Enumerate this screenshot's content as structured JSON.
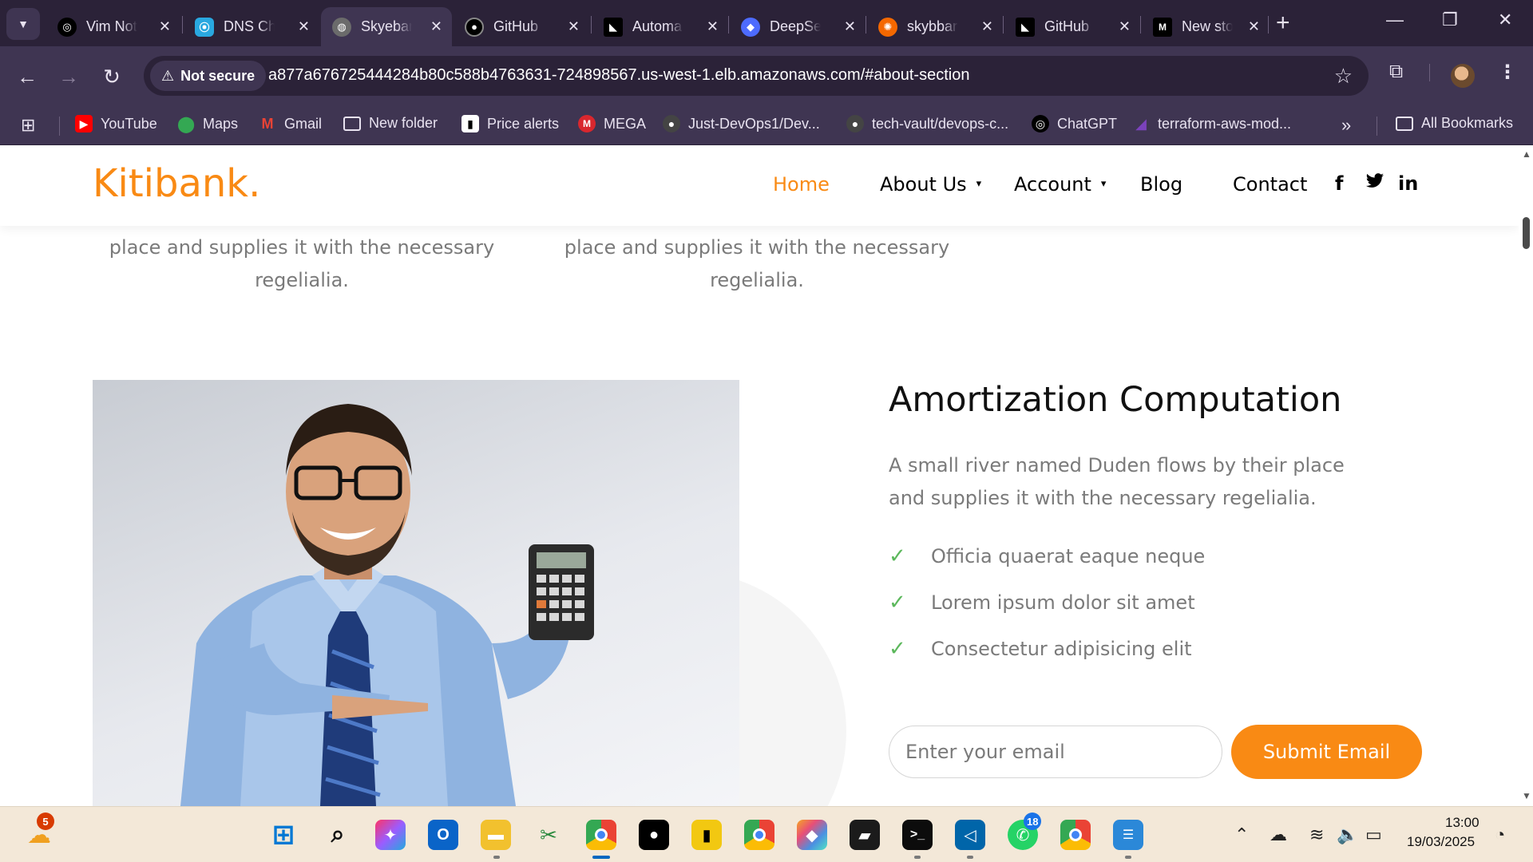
{
  "browser": {
    "tabs": [
      {
        "title": "Vim Not",
        "icon": "openai-icon",
        "color": "#000000"
      },
      {
        "title": "DNS Ch",
        "icon": "dns-checker-icon",
        "color": "#29a8e0"
      },
      {
        "title": "Skyeban",
        "icon": "globe-icon",
        "color": "#6b6b6b",
        "active": true
      },
      {
        "title": "GitHub",
        "icon": "github-icon",
        "color": "#000000"
      },
      {
        "title": "Automa",
        "icon": "automa-icon",
        "color": "#000000"
      },
      {
        "title": "DeepSe",
        "icon": "deepseek-icon",
        "color": "#4d6bfe"
      },
      {
        "title": "skybbar",
        "icon": "grafana-icon",
        "color": "#f46800"
      },
      {
        "title": "GitHub",
        "icon": "github-icon",
        "color": "#000000"
      },
      {
        "title": "New sto",
        "icon": "medium-icon",
        "color": "#000000"
      }
    ],
    "omnibox": {
      "security_label": "Not secure",
      "url": "a877a676725444284b80c588b4763631-724898567.us-west-1.elb.amazonaws.com/#about-section"
    },
    "bookmarks": [
      {
        "label": "YouTube",
        "icon": "youtube-icon",
        "color": "#ff0000"
      },
      {
        "label": "Maps",
        "icon": "maps-icon",
        "color": "#34a853"
      },
      {
        "label": "Gmail",
        "icon": "gmail-icon",
        "color": "#ea4335"
      },
      {
        "label": "New folder",
        "icon": "folder-icon",
        "color": "#e8e2f0"
      },
      {
        "label": "Price alerts",
        "icon": "price-alerts-icon",
        "color": "#ffffff"
      },
      {
        "label": "MEGA",
        "icon": "mega-icon",
        "color": "#d9272e"
      },
      {
        "label": "Just-DevOps1/Dev...",
        "icon": "github-icon",
        "color": "#444444"
      },
      {
        "label": "tech-vault/devops-c...",
        "icon": "github-icon",
        "color": "#444444"
      },
      {
        "label": "ChatGPT",
        "icon": "openai-icon",
        "color": "#000000"
      },
      {
        "label": "terraform-aws-mod...",
        "icon": "terraform-icon",
        "color": "#7b42bc"
      }
    ],
    "all_bookmarks_label": "All Bookmarks"
  },
  "site": {
    "logo": "Kitibank.",
    "nav": [
      {
        "label": "Home",
        "active": true
      },
      {
        "label": "About Us",
        "dropdown": true
      },
      {
        "label": "Account",
        "dropdown": true
      },
      {
        "label": "Blog"
      },
      {
        "label": "Contact"
      }
    ],
    "social": [
      "f",
      "twitter",
      "in"
    ],
    "features": [
      {
        "text": "A small river named Duden flows by their place and supplies it with the necessary regelialia."
      },
      {
        "text": "A small river named Duden flows by their place and supplies it with the necessary regelialia."
      }
    ],
    "about": {
      "title": "Amortization Computation",
      "description": "A small river named Duden flows by their place and supplies it with the necessary regelialia.",
      "checklist": [
        "Officia quaerat eaque neque",
        "Lorem ipsum dolor sit amet",
        "Consectetur adipisicing elit"
      ],
      "email_placeholder": "Enter your email",
      "submit_label": "Submit Email"
    },
    "colors": {
      "accent": "#f98a14",
      "check": "#5cb85c",
      "text_muted": "#7a7a7a"
    }
  },
  "taskbar": {
    "weather_badge": "5",
    "whatsapp_badge": "18",
    "clock_time": "13:00",
    "clock_date": "19/03/2025"
  }
}
